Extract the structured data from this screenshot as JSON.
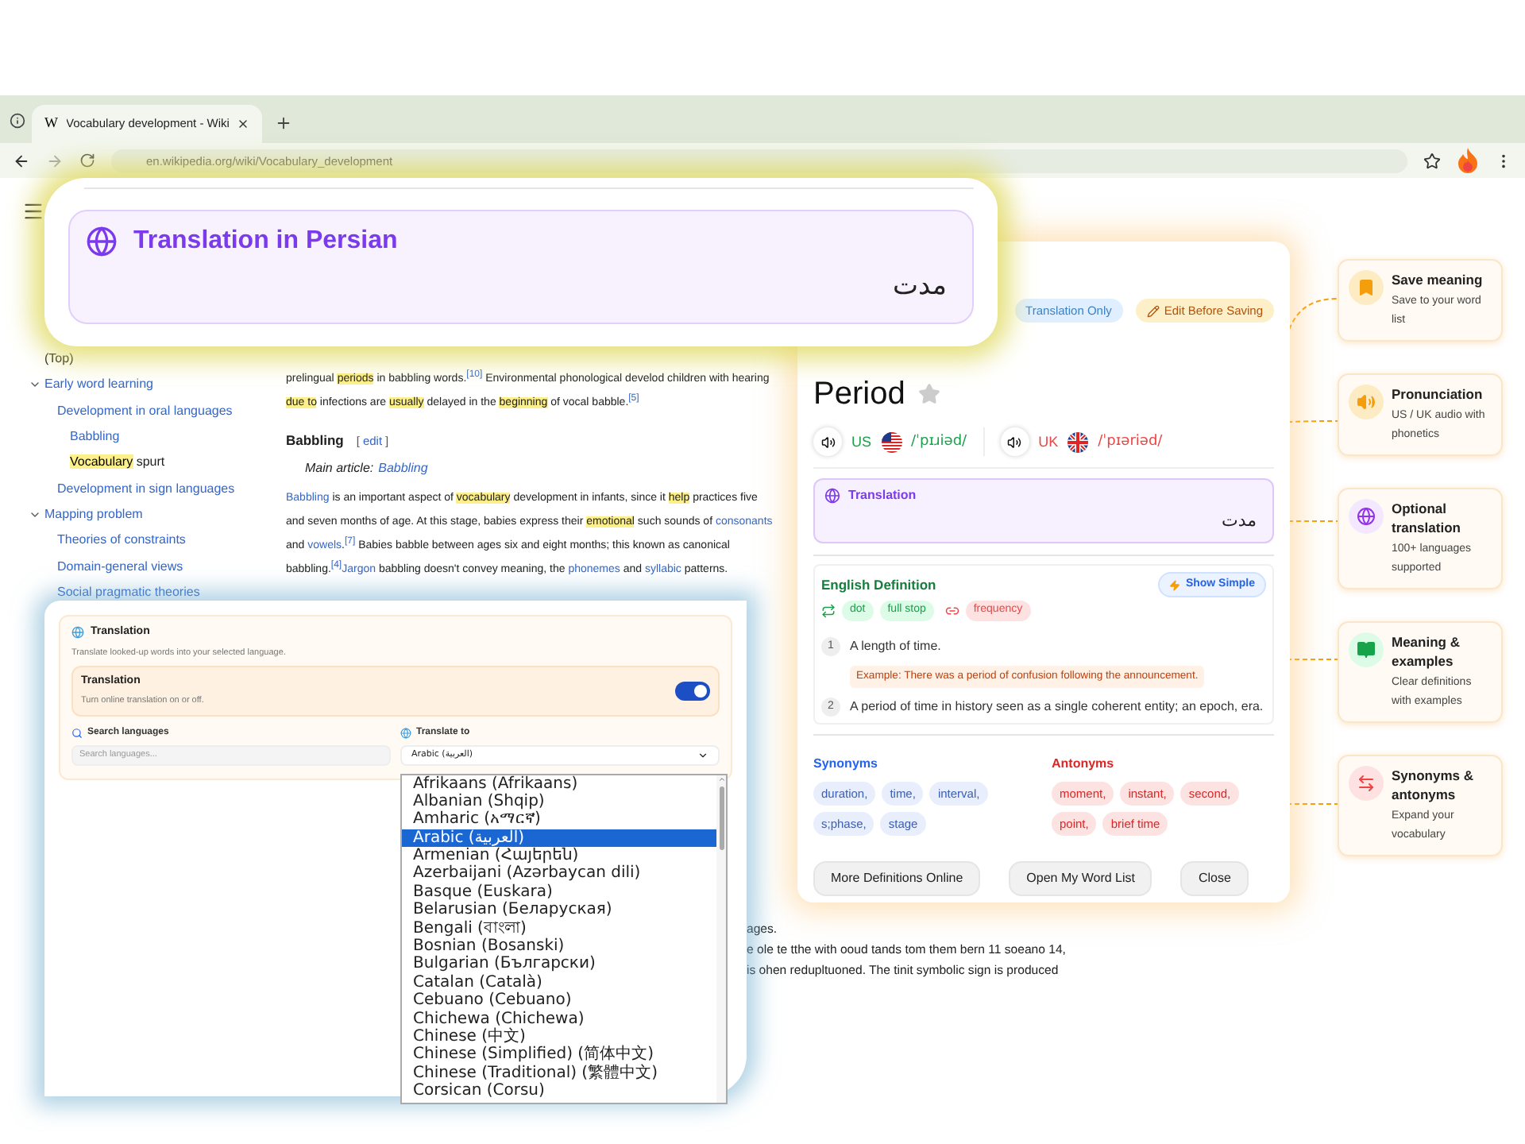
{
  "browser": {
    "favicon_letter": "W",
    "tab_title": "Vocabulary development - Wiki",
    "url": "en.wikipedia.org/wiki/Vocabulary_development"
  },
  "sidebar": {
    "items": [
      {
        "label": [
          {
            "kind": "plain",
            "text": "(Top)"
          }
        ]
      },
      {
        "label": [
          {
            "kind": "link",
            "text": "Early word learning"
          }
        ],
        "expanded": true,
        "children": [
          {
            "label": [
              {
                "kind": "link",
                "text": "Development in oral languages"
              }
            ],
            "children": [
              {
                "label": [
                  {
                    "kind": "link",
                    "text": "Babbling"
                  }
                ]
              },
              {
                "label": [
                  {
                    "kind": "highlight",
                    "text": "Vocabulary"
                  },
                  {
                    "kind": "plain",
                    "text": " spurt"
                  }
                ]
              }
            ]
          },
          {
            "label": [
              {
                "kind": "link",
                "text": "Development in sign languages"
              }
            ]
          }
        ]
      },
      {
        "label": [
          {
            "kind": "link",
            "text": "Mapping problem"
          }
        ],
        "expanded": true,
        "children": [
          {
            "label": [
              {
                "kind": "link",
                "text": "Theories of constraints"
              }
            ]
          },
          {
            "label": [
              {
                "kind": "link",
                "text": "Domain-general views"
              }
            ]
          },
          {
            "label": [
              {
                "kind": "link",
                "text": "Social pragmatic theories"
              }
            ]
          }
        ]
      }
    ]
  },
  "article": {
    "intro": [
      {
        "kind": "plain",
        "text": "prelingual "
      },
      {
        "kind": "highlight",
        "text": "periods"
      },
      {
        "kind": "plain",
        "text": " in babbling words."
      },
      {
        "kind": "ref",
        "text": "[10]"
      },
      {
        "kind": "plain",
        "text": " Environmental phonological develod children with hearing "
      },
      {
        "kind": "highlight",
        "text": "due to"
      },
      {
        "kind": "plain",
        "text": " infections are "
      },
      {
        "kind": "highlight",
        "text": "usually"
      },
      {
        "kind": "plain",
        "text": " delayed in the "
      },
      {
        "kind": "highlight",
        "text": "beginning"
      },
      {
        "kind": "plain",
        "text": " of vocal babble."
      },
      {
        "kind": "ref",
        "text": "[5]"
      }
    ],
    "heading": "Babbling",
    "edit_open": "[",
    "edit": "edit",
    "edit_close": "]",
    "main_prefix": "Main article:",
    "main_link": "Babbling",
    "paragraph": [
      {
        "kind": "link",
        "text": "Babbling"
      },
      {
        "kind": "plain",
        "text": " is an important aspect of "
      },
      {
        "kind": "highlight",
        "text": "vocabulary"
      },
      {
        "kind": "plain",
        "text": " development in infants, since it "
      },
      {
        "kind": "highlight",
        "text": "help"
      },
      {
        "kind": "plain",
        "text": " practices five and seven months of age. At this stage, babies express their "
      },
      {
        "kind": "highlight",
        "text": "emotional"
      },
      {
        "kind": "plain",
        "text": " such sounds of "
      },
      {
        "kind": "link",
        "text": "consonants"
      },
      {
        "kind": "plain",
        "text": " and "
      },
      {
        "kind": "link",
        "text": "vowels"
      },
      {
        "kind": "plain",
        "text": "."
      },
      {
        "kind": "ref",
        "text": "[7]"
      },
      {
        "kind": "plain",
        "text": " Babies babble between ages six and eight months; this known as canonical babbling."
      },
      {
        "kind": "ref",
        "text": "[4]"
      },
      {
        "kind": "link",
        "text": "Jargon"
      },
      {
        "kind": "plain",
        "text": " babbling doesn't convey meaning, the "
      },
      {
        "kind": "link",
        "text": "phonemes"
      },
      {
        "kind": "plain",
        "text": " and "
      },
      {
        "kind": "link",
        "text": "syllabic"
      },
      {
        "kind": "plain",
        "text": " patterns."
      }
    ],
    "tail": [
      "ages.",
      "e ole te tthe with ooud tands tom them bern 11 soeano 14,",
      "is ohen redupltuoned. The tinit symbolic sign is produced"
    ]
  },
  "callout": {
    "title": "Translation in Persian",
    "text": "مدت"
  },
  "popup": {
    "badges": [
      {
        "kind": "info",
        "label": "Translation Only"
      },
      {
        "kind": "edit",
        "label": "Edit Before Saving"
      }
    ],
    "word": "Period",
    "starred": false,
    "pronunciations": [
      {
        "kind": "us",
        "region": "US",
        "phonetic": "/ˈpɪɹiəd/",
        "color": "#16a34a"
      },
      {
        "kind": "uk",
        "region": "UK",
        "phonetic": "/ˈpɪəriəd/",
        "color": "#ef4444"
      }
    ],
    "translation": {
      "label": "Translation",
      "text": "مدت"
    },
    "definition": {
      "title": "English Definition",
      "toggle": "Show Simple",
      "tags": [
        {
          "kind": "synonym",
          "label": "dot"
        },
        {
          "kind": "synonym",
          "label": "full stop"
        },
        {
          "kind": "related",
          "label": "frequency"
        }
      ],
      "senses": [
        {
          "number": "1",
          "text": "A length of time.",
          "example": "Example: There was a period of confusion following the announcement."
        },
        {
          "number": "2",
          "text": "A period of time in history seen as a single coherent entity; an epoch, era."
        }
      ]
    },
    "synonyms": {
      "title": "Synonyms",
      "items": [
        "duration,",
        "time,",
        "interval,",
        "s;phase,",
        "stage"
      ]
    },
    "antonyms": {
      "title": "Antonyms",
      "items": [
        "moment,",
        "instant,",
        "second,",
        "point,",
        "brief time"
      ]
    },
    "buttons": [
      "More Definitions Online",
      "Open My Word List",
      "Close"
    ]
  },
  "features": [
    {
      "kind": "save",
      "title": "Save meaning",
      "text": "Save to your word list"
    },
    {
      "kind": "pronunciation",
      "title": "Pronunciation",
      "text": "US / UK audio with phonetics"
    },
    {
      "kind": "translation",
      "title": "Optional translation",
      "text": "100+ languages supported"
    },
    {
      "kind": "meaning",
      "title": "Meaning & examples",
      "text": "Clear definitions with examples"
    },
    {
      "kind": "synonyms",
      "title": "Synonyms & antonyms",
      "text": "Expand your vocabulary"
    }
  ],
  "settings": {
    "title": "Translation",
    "description": "Translate looked-up words into your selected language.",
    "toggle": {
      "label": "Translation",
      "description": "Turn online translation on or off.",
      "on": true
    },
    "search": {
      "label": "Search languages",
      "placeholder": "Search languages..."
    },
    "target": {
      "label": "Translate to",
      "value": "Arabic (العربية)"
    },
    "languages": [
      {
        "label": "Afrikaans (Afrikaans)",
        "selected": false
      },
      {
        "label": "Albanian (Shqip)",
        "selected": false
      },
      {
        "label": "Amharic (አማርኛ)",
        "selected": false
      },
      {
        "label": "Arabic (العربية)",
        "selected": true
      },
      {
        "label": "Armenian (Հայերեն)",
        "selected": false
      },
      {
        "label": "Azerbaijani (Azərbaycan dili)",
        "selected": false
      },
      {
        "label": "Basque (Euskara)",
        "selected": false
      },
      {
        "label": "Belarusian (Беларуская)",
        "selected": false
      },
      {
        "label": "Bengali (বাংলা)",
        "selected": false
      },
      {
        "label": "Bosnian (Bosanski)",
        "selected": false
      },
      {
        "label": "Bulgarian (Български)",
        "selected": false
      },
      {
        "label": "Catalan (Català)",
        "selected": false
      },
      {
        "label": "Cebuano (Cebuano)",
        "selected": false
      },
      {
        "label": "Chichewa (Chichewa)",
        "selected": false
      },
      {
        "label": "Chinese (中文)",
        "selected": false
      },
      {
        "label": "Chinese (Simplified) (简体中文)",
        "selected": false
      },
      {
        "label": "Chinese (Traditional) (繁體中文)",
        "selected": false
      },
      {
        "label": "Corsican (Corsu)",
        "selected": false
      }
    ]
  }
}
